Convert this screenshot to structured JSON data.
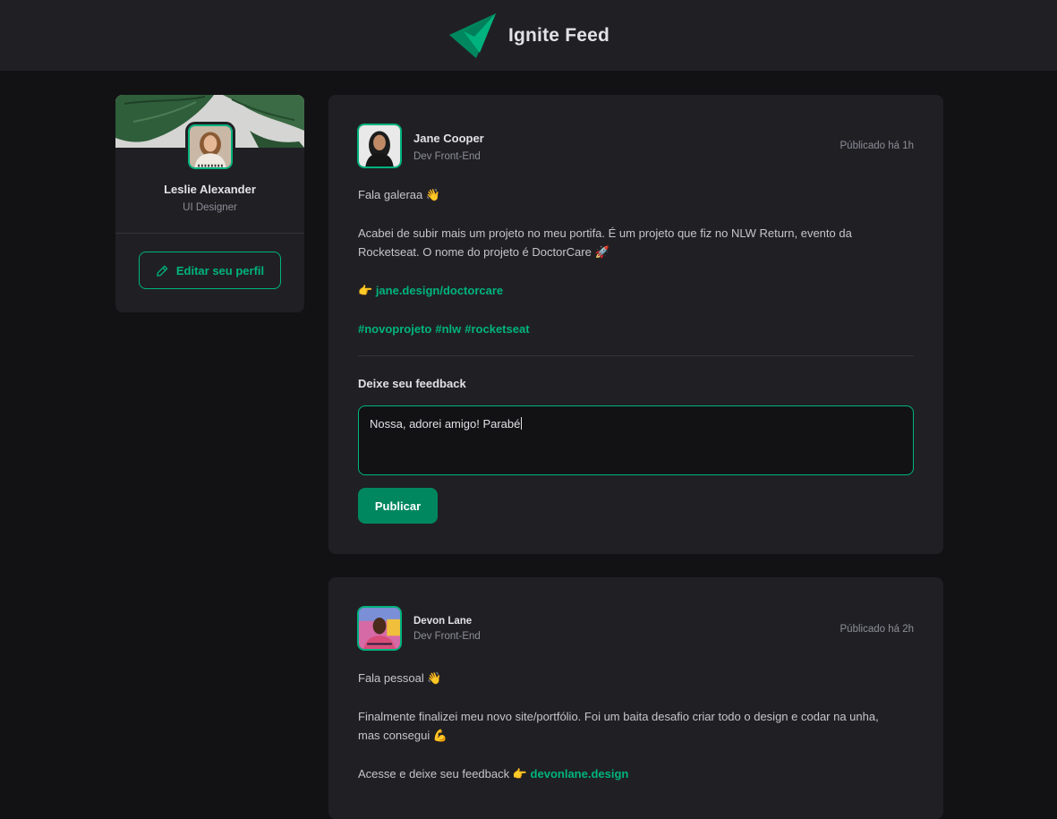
{
  "app": {
    "title": "Ignite Feed"
  },
  "profile": {
    "name": "Leslie Alexander",
    "role": "UI Designer",
    "edit_label": "Editar seu perfil"
  },
  "posts": [
    {
      "author": "Jane Cooper",
      "role": "Dev Front-End",
      "published": "Públicado há 1h",
      "greeting": "Fala galeraa 👋",
      "body_line1": "Acabei de subir mais um projeto no meu portifa. É um projeto que fiz no NLW Return, evento da",
      "body_line2": "Rocketseat. O nome do projeto é DoctorCare 🚀",
      "link_prefix": "👉",
      "link": "jane.design/doctorcare",
      "hashtags": [
        "#novoprojeto",
        "#nlw",
        "#rocketseat"
      ],
      "feedback_title": "Deixe seu feedback",
      "feedback_value": "Nossa, adorei amigo! Parabé",
      "publish_label": "Publicar"
    },
    {
      "author": "Devon Lane",
      "role": "Dev Front-End",
      "published": "Públicado há 2h",
      "greeting": "Fala pessoal 👋",
      "body_line1": "Finalmente finalizei meu novo site/portfólio. Foi um baita desafio criar todo o design e codar na unha,",
      "body_line2": "mas consegui 💪",
      "cta_text": "Acesse e deixe seu feedback",
      "link_prefix": "👉",
      "link": "devonlane.design"
    }
  ],
  "colors": {
    "accent": "#00b37e",
    "button": "#00875f",
    "background": "#121214",
    "surface": "#202024"
  }
}
